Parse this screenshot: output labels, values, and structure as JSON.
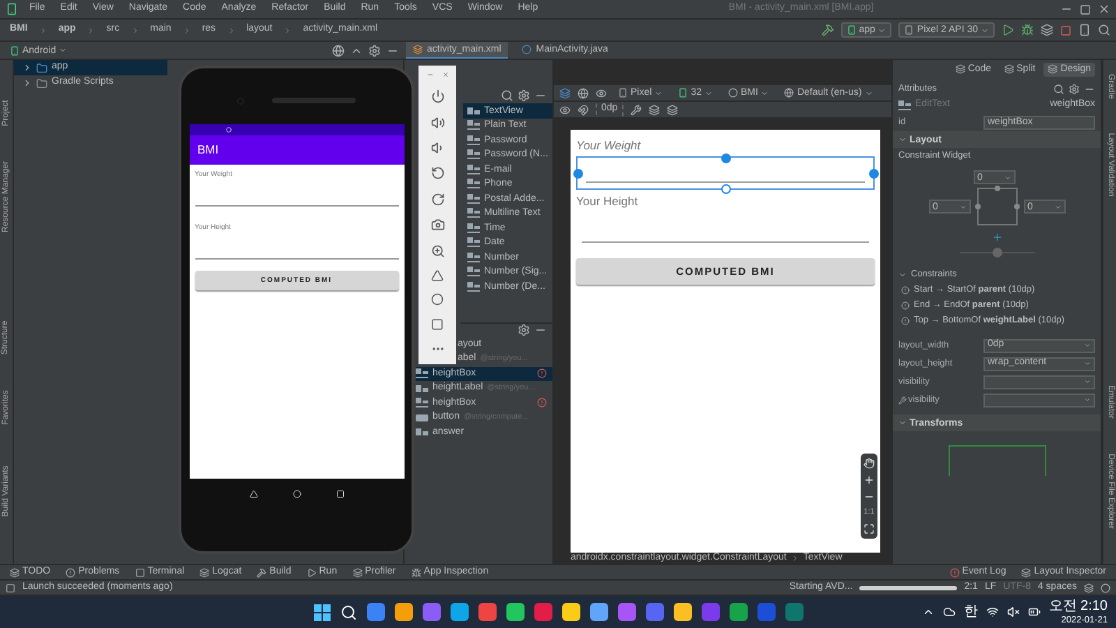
{
  "menu_bar": {
    "items": [
      "File",
      "Edit",
      "View",
      "Navigate",
      "Code",
      "Analyze",
      "Refactor",
      "Build",
      "Run",
      "Tools",
      "VCS",
      "Window",
      "Help"
    ],
    "title": "BMI - activity_main.xml [BMI.app]"
  },
  "breadcrumb": [
    "BMI",
    "app",
    "src",
    "main",
    "res",
    "layout",
    "activity_main.xml"
  ],
  "run_config": "app",
  "device": "Pixel 2 API 30",
  "project_panel": {
    "view": "Android",
    "tree": [
      {
        "label": "app",
        "selected": true
      },
      {
        "label": "Gradle Scripts",
        "selected": false
      }
    ]
  },
  "editor_tabs": [
    {
      "label": "activity_main.xml",
      "selected": true
    },
    {
      "label": "MainActivity.java",
      "selected": false
    }
  ],
  "left_stripe": [
    "Project",
    "Resource Manager",
    "Structure",
    "Favorites",
    "Build Variants"
  ],
  "right_stripe": [
    "Gradle",
    "Layout Validation",
    "Emulator",
    "Device File Explorer"
  ],
  "emulator": {
    "app_title": "BMI",
    "weight_label": "Your Weight",
    "height_label": "Your Height",
    "button": "COMPUTED BMI"
  },
  "palette": [
    {
      "label": "TextView",
      "selected": true
    },
    {
      "label": "Plain Text",
      "selected": false
    },
    {
      "label": "Password",
      "selected": false
    },
    {
      "label": "Password (N...",
      "selected": false
    },
    {
      "label": "E-mail",
      "selected": false
    },
    {
      "label": "Phone",
      "selected": false
    },
    {
      "label": "Postal Adde...",
      "selected": false
    },
    {
      "label": "Multiline Text",
      "selected": false
    },
    {
      "label": "Time",
      "selected": false
    },
    {
      "label": "Date",
      "selected": false
    },
    {
      "label": "Number",
      "selected": false
    },
    {
      "label": "Number (Sig...",
      "selected": false
    },
    {
      "label": "Number (De...",
      "selected": false
    }
  ],
  "component_tree": [
    {
      "label": "ayout",
      "covered": true,
      "selected": false,
      "error": false
    },
    {
      "label": "abel",
      "hint": "@string/you...",
      "covered": true,
      "selected": false,
      "error": false
    },
    {
      "label": "heightBox",
      "kind": "edittext",
      "selected": true,
      "error": true
    },
    {
      "label": "heightLabel",
      "hint": "@string/you...",
      "kind": "textview",
      "selected": false,
      "error": false
    },
    {
      "label": "heightBox",
      "kind": "edittext",
      "selected": false,
      "error": true
    },
    {
      "label": "button",
      "hint": "@string/compute...",
      "kind": "button",
      "selected": false,
      "error": false
    },
    {
      "label": "answer",
      "kind": "textview",
      "selected": false,
      "error": false
    }
  ],
  "view_modes": [
    {
      "label": "Code",
      "selected": false
    },
    {
      "label": "Split",
      "selected": false
    },
    {
      "label": "Design",
      "selected": true
    }
  ],
  "design_toolbar": {
    "device": "Pixel",
    "api": "32",
    "theme": "BMI",
    "locale": "Default (en-us)",
    "margin": "0dp"
  },
  "canvas": {
    "weight_label": "Your Weight",
    "height_label": "Your Height",
    "button": "COMPUTED BMI",
    "zoom": "1:1"
  },
  "attributes": {
    "title": "Attributes",
    "widget": "EditText",
    "widget_id": "weightBox",
    "id_label": "id",
    "id_value": "weightBox",
    "layout_section": "Layout",
    "constraint_widget": "Constraint Widget",
    "margins": [
      "0",
      "0",
      "0"
    ],
    "bias_slider": {
      "level": 0.5
    },
    "constraints_heading": "Constraints",
    "constraints": [
      "Start → StartOf **parent** (10dp)",
      "End → EndOf **parent** (10dp)",
      "Top → BottomOf **weightLabel** (10dp)"
    ],
    "properties": [
      {
        "name": "layout_width",
        "value": "0dp",
        "kind": "plain"
      },
      {
        "name": "layout_height",
        "value": "wrap_content",
        "kind": "plain"
      },
      {
        "name": "visibility",
        "kind": "plain"
      },
      {
        "name": "visibility",
        "kind": "tool"
      }
    ],
    "transforms": "Transforms"
  },
  "component_path": [
    "androidx.constraintlayout.widget.ConstraintLayout",
    "TextView"
  ],
  "tool_windows": [
    "TODO",
    "Problems",
    "Terminal",
    "Logcat",
    "Build",
    "Run",
    "Profiler",
    "App Inspection"
  ],
  "right_tools": [
    "Event Log",
    "Layout Inspector"
  ],
  "status": {
    "message": "Launch succeeded (moments ago)",
    "task": "Starting AVD...",
    "level": 1,
    "position": "2:1",
    "line_sep": "LF",
    "encoding": "UTF-8",
    "indent": "4 spaces"
  },
  "taskbar": {
    "ime": "한",
    "time": "오전 2:10",
    "date": "2022-01-21"
  }
}
